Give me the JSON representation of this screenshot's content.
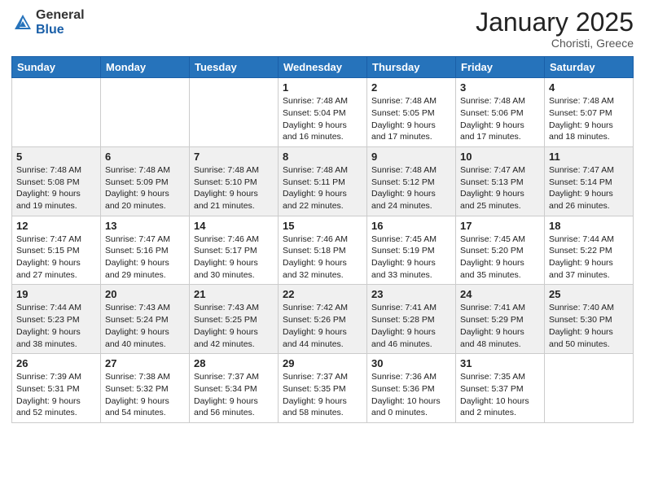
{
  "header": {
    "logo_general": "General",
    "logo_blue": "Blue",
    "month": "January 2025",
    "location": "Choristi, Greece"
  },
  "weekdays": [
    "Sunday",
    "Monday",
    "Tuesday",
    "Wednesday",
    "Thursday",
    "Friday",
    "Saturday"
  ],
  "weeks": [
    [
      {
        "day": "",
        "info": ""
      },
      {
        "day": "",
        "info": ""
      },
      {
        "day": "",
        "info": ""
      },
      {
        "day": "1",
        "info": "Sunrise: 7:48 AM\nSunset: 5:04 PM\nDaylight: 9 hours\nand 16 minutes."
      },
      {
        "day": "2",
        "info": "Sunrise: 7:48 AM\nSunset: 5:05 PM\nDaylight: 9 hours\nand 17 minutes."
      },
      {
        "day": "3",
        "info": "Sunrise: 7:48 AM\nSunset: 5:06 PM\nDaylight: 9 hours\nand 17 minutes."
      },
      {
        "day": "4",
        "info": "Sunrise: 7:48 AM\nSunset: 5:07 PM\nDaylight: 9 hours\nand 18 minutes."
      }
    ],
    [
      {
        "day": "5",
        "info": "Sunrise: 7:48 AM\nSunset: 5:08 PM\nDaylight: 9 hours\nand 19 minutes."
      },
      {
        "day": "6",
        "info": "Sunrise: 7:48 AM\nSunset: 5:09 PM\nDaylight: 9 hours\nand 20 minutes."
      },
      {
        "day": "7",
        "info": "Sunrise: 7:48 AM\nSunset: 5:10 PM\nDaylight: 9 hours\nand 21 minutes."
      },
      {
        "day": "8",
        "info": "Sunrise: 7:48 AM\nSunset: 5:11 PM\nDaylight: 9 hours\nand 22 minutes."
      },
      {
        "day": "9",
        "info": "Sunrise: 7:48 AM\nSunset: 5:12 PM\nDaylight: 9 hours\nand 24 minutes."
      },
      {
        "day": "10",
        "info": "Sunrise: 7:47 AM\nSunset: 5:13 PM\nDaylight: 9 hours\nand 25 minutes."
      },
      {
        "day": "11",
        "info": "Sunrise: 7:47 AM\nSunset: 5:14 PM\nDaylight: 9 hours\nand 26 minutes."
      }
    ],
    [
      {
        "day": "12",
        "info": "Sunrise: 7:47 AM\nSunset: 5:15 PM\nDaylight: 9 hours\nand 27 minutes."
      },
      {
        "day": "13",
        "info": "Sunrise: 7:47 AM\nSunset: 5:16 PM\nDaylight: 9 hours\nand 29 minutes."
      },
      {
        "day": "14",
        "info": "Sunrise: 7:46 AM\nSunset: 5:17 PM\nDaylight: 9 hours\nand 30 minutes."
      },
      {
        "day": "15",
        "info": "Sunrise: 7:46 AM\nSunset: 5:18 PM\nDaylight: 9 hours\nand 32 minutes."
      },
      {
        "day": "16",
        "info": "Sunrise: 7:45 AM\nSunset: 5:19 PM\nDaylight: 9 hours\nand 33 minutes."
      },
      {
        "day": "17",
        "info": "Sunrise: 7:45 AM\nSunset: 5:20 PM\nDaylight: 9 hours\nand 35 minutes."
      },
      {
        "day": "18",
        "info": "Sunrise: 7:44 AM\nSunset: 5:22 PM\nDaylight: 9 hours\nand 37 minutes."
      }
    ],
    [
      {
        "day": "19",
        "info": "Sunrise: 7:44 AM\nSunset: 5:23 PM\nDaylight: 9 hours\nand 38 minutes."
      },
      {
        "day": "20",
        "info": "Sunrise: 7:43 AM\nSunset: 5:24 PM\nDaylight: 9 hours\nand 40 minutes."
      },
      {
        "day": "21",
        "info": "Sunrise: 7:43 AM\nSunset: 5:25 PM\nDaylight: 9 hours\nand 42 minutes."
      },
      {
        "day": "22",
        "info": "Sunrise: 7:42 AM\nSunset: 5:26 PM\nDaylight: 9 hours\nand 44 minutes."
      },
      {
        "day": "23",
        "info": "Sunrise: 7:41 AM\nSunset: 5:28 PM\nDaylight: 9 hours\nand 46 minutes."
      },
      {
        "day": "24",
        "info": "Sunrise: 7:41 AM\nSunset: 5:29 PM\nDaylight: 9 hours\nand 48 minutes."
      },
      {
        "day": "25",
        "info": "Sunrise: 7:40 AM\nSunset: 5:30 PM\nDaylight: 9 hours\nand 50 minutes."
      }
    ],
    [
      {
        "day": "26",
        "info": "Sunrise: 7:39 AM\nSunset: 5:31 PM\nDaylight: 9 hours\nand 52 minutes."
      },
      {
        "day": "27",
        "info": "Sunrise: 7:38 AM\nSunset: 5:32 PM\nDaylight: 9 hours\nand 54 minutes."
      },
      {
        "day": "28",
        "info": "Sunrise: 7:37 AM\nSunset: 5:34 PM\nDaylight: 9 hours\nand 56 minutes."
      },
      {
        "day": "29",
        "info": "Sunrise: 7:37 AM\nSunset: 5:35 PM\nDaylight: 9 hours\nand 58 minutes."
      },
      {
        "day": "30",
        "info": "Sunrise: 7:36 AM\nSunset: 5:36 PM\nDaylight: 10 hours\nand 0 minutes."
      },
      {
        "day": "31",
        "info": "Sunrise: 7:35 AM\nSunset: 5:37 PM\nDaylight: 10 hours\nand 2 minutes."
      },
      {
        "day": "",
        "info": ""
      }
    ]
  ]
}
